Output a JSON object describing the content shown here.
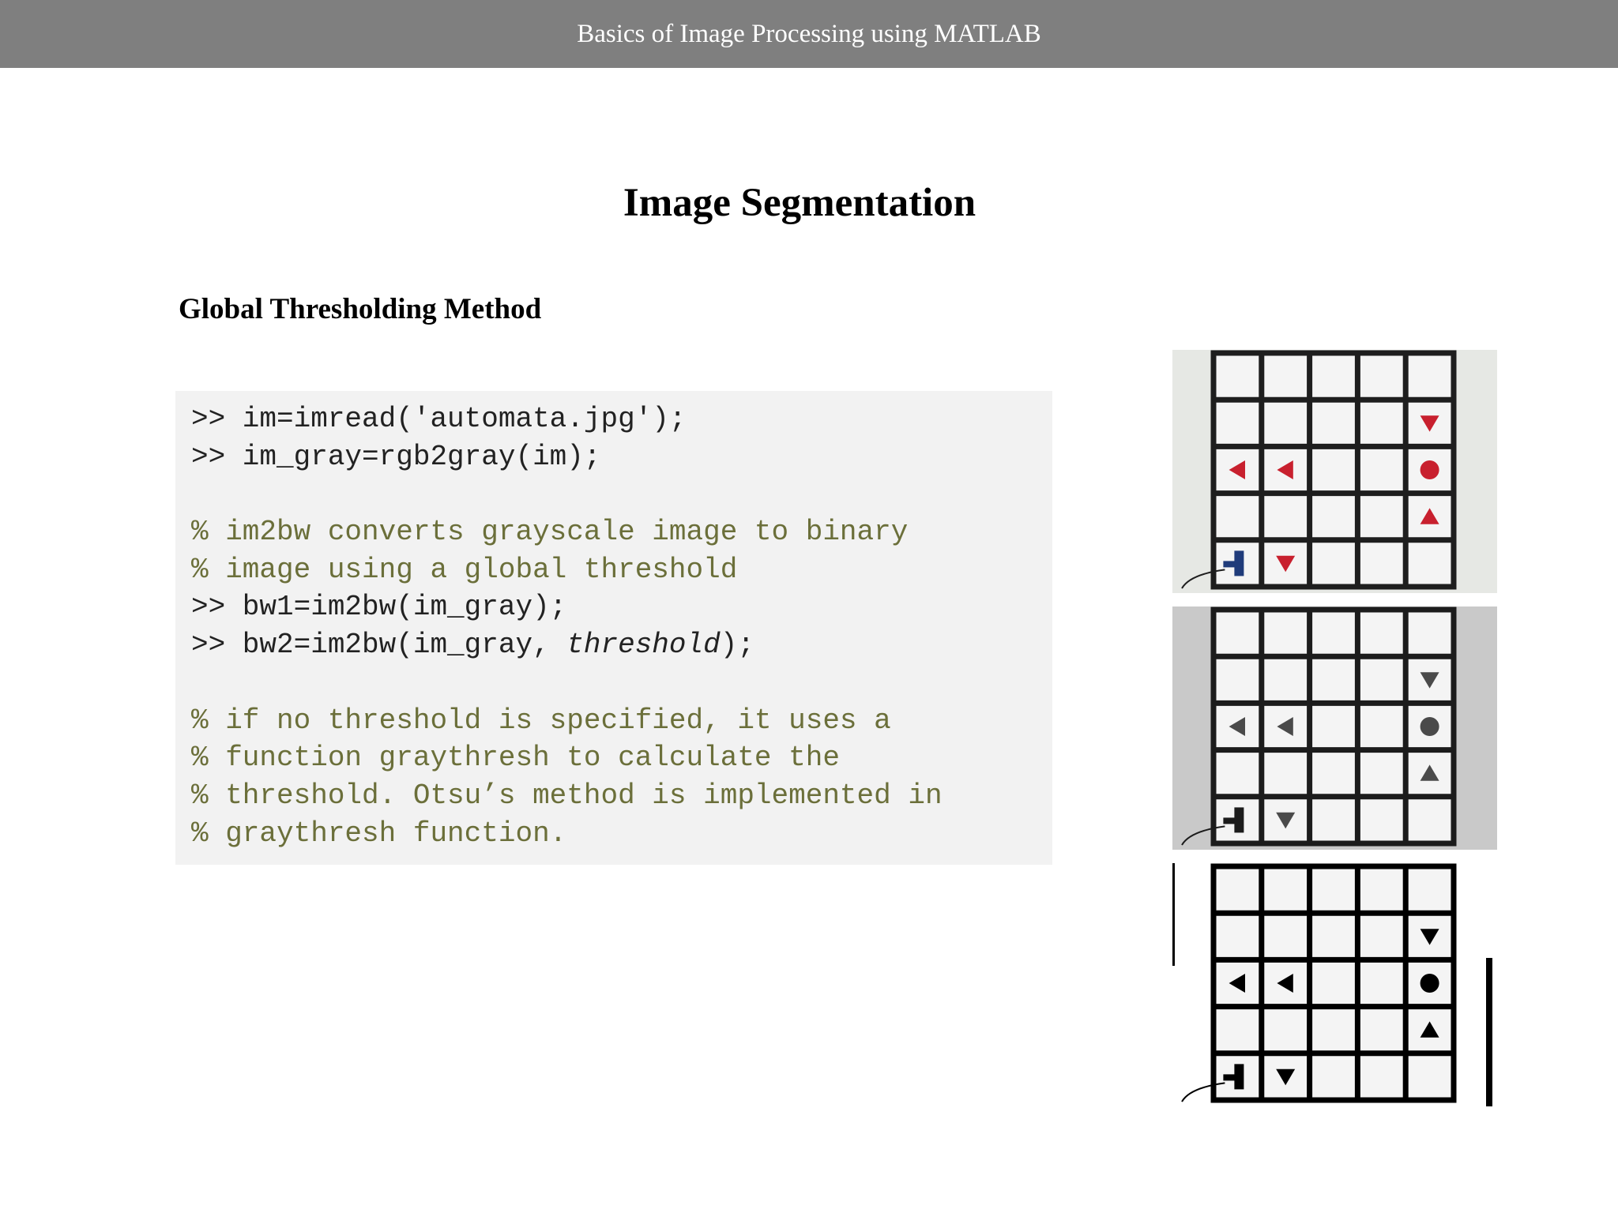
{
  "header": {
    "title": "Basics of Image Processing using MATLAB"
  },
  "slide": {
    "title": "Image Segmentation",
    "subtitle": "Global Thresholding Method"
  },
  "code": {
    "line1": ">> im=imread('automata.jpg');",
    "line2": ">> im_gray=rgb2gray(im);",
    "line3": "% im2bw converts grayscale image to binary",
    "line4": "% image using a global threshold",
    "line5": ">> bw1=im2bw(im_gray);",
    "line6a": ">> bw2=im2bw(im_gray, ",
    "line6b": "threshold",
    "line6c": ");",
    "line7": "% if no threshold is specified, it uses a",
    "line8": "% function graythresh to calculate the",
    "line9": "% threshold. Otsu’s method is implemented in",
    "line10": "% graythresh function."
  },
  "images": {
    "colors": {
      "color_bg": "#e6e8e4",
      "color_grid": "#1e1e1e",
      "color_shape": "#c8202e",
      "gray_bg": "#c9c9c9",
      "gray_grid": "#1c1c1c",
      "gray_shape": "#4a4a4a",
      "binary_bg": "#ffffff",
      "binary_grid": "#000000",
      "binary_shape": "#000000"
    }
  }
}
